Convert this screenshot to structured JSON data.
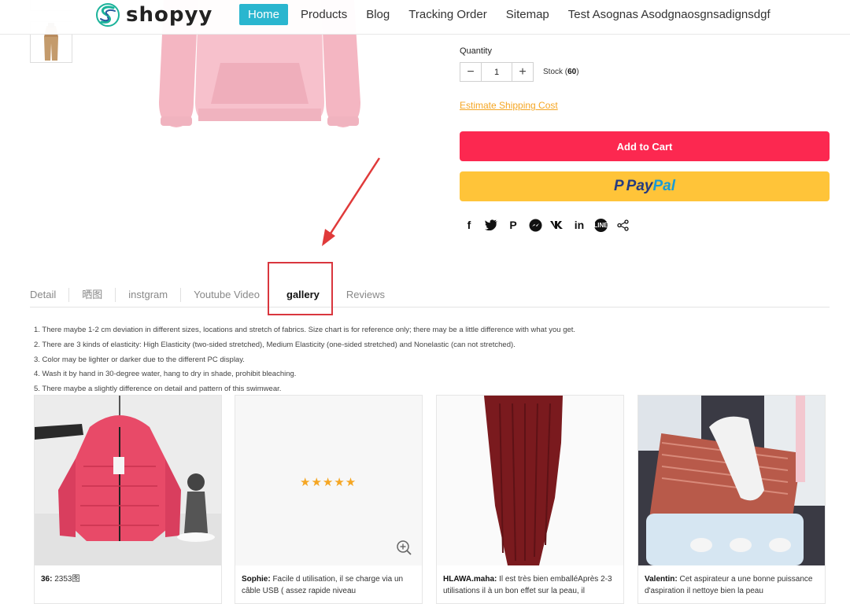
{
  "header": {
    "logo_text": "shopyy",
    "nav": [
      "Home",
      "Products",
      "Blog",
      "Tracking Order",
      "Sitemap",
      "Test Asognas Asodgnaosgnsadignsdgf"
    ]
  },
  "product": {
    "quantity_label": "Quantity",
    "quantity_value": "1",
    "minus": "−",
    "plus": "+",
    "stock_prefix": "Stock (",
    "stock_value": "60",
    "stock_suffix": ")",
    "shipping_link": "Estimate Shipping Cost",
    "add_to_cart": "Add to Cart",
    "paypal_pay": "Pay",
    "paypal_pal": "Pal"
  },
  "share_icons": [
    "facebook-icon",
    "twitter-icon",
    "pinterest-icon",
    "messenger-icon",
    "vk-icon",
    "linkedin-icon",
    "line-icon",
    "share-icon"
  ],
  "tabs": [
    "Detail",
    "晒图",
    "instgram",
    "Youtube Video",
    "gallery",
    "Reviews"
  ],
  "active_tab": "gallery",
  "description": [
    "1. There maybe 1-2 cm deviation in different sizes, locations and stretch of fabrics. Size chart is for reference only; there may be a little difference with what you get.",
    "2. There are 3 kinds of elasticity: High Elasticity (two-sided stretched), Medium Elasticity (one-sided stretched) and Nonelastic (can not stretched).",
    "3. Color may be lighter or darker due to the different PC display.",
    "4. Wash it by hand in 30-degree water, hang to dry in shade, prohibit bleaching.",
    "5. There maybe a slightly difference on detail and pattern of this swimwear."
  ],
  "gallery": [
    {
      "author": "36:",
      "text": "2353图"
    },
    {
      "author": "Sophie:",
      "text": "Facile d utilisation, il se charge via un câble USB ( assez rapide niveau",
      "stars": "★★★★★"
    },
    {
      "author": "HLAWA.maha:",
      "text": "Il est très bien emballéAprès 2-3 utilisations il à un bon effet sur la peau, il"
    },
    {
      "author": "Valentin:",
      "text": "Cet aspirateur a une bonne puissance d'aspiration il nettoye bien la peau"
    }
  ],
  "colors": {
    "nav_active": "#2ab6cf",
    "add_to_cart": "#fc2850",
    "paypal": "#ffc439",
    "shipping_link": "#f5a623",
    "annotation": "#d9363e"
  }
}
